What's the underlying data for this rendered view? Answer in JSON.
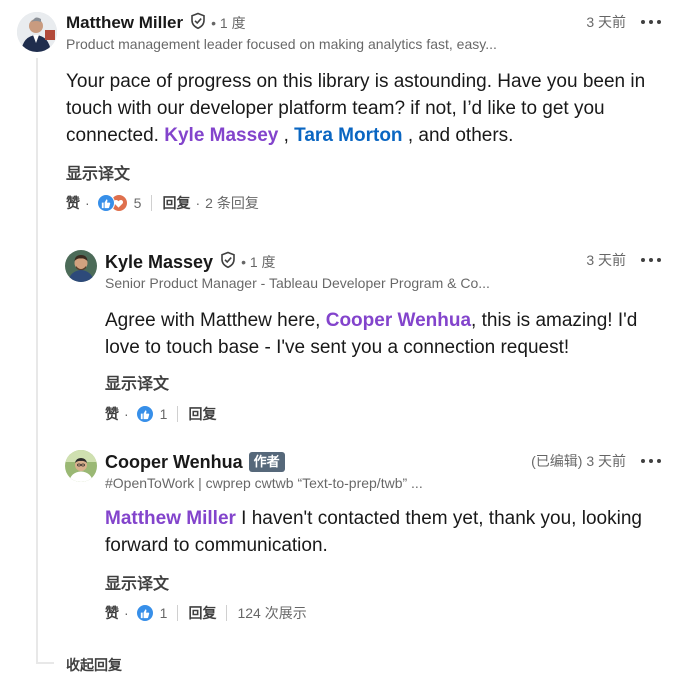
{
  "thread": {
    "collapse_label": "收起回复"
  },
  "comments": [
    {
      "name": "Matthew Miller",
      "degree": "• 1 度",
      "headline": "Product management leader focused on making analytics fast, easy...",
      "time": "3 天前",
      "text_1": "Your pace of progress on this library is astounding. Have you been in touch with our developer platform team? if not, I’d like to get you connected. ",
      "mention_1": "Kyle Massey",
      "text_2": " , ",
      "mention_2": "Tara Morton",
      "text_3": " , and others.",
      "translate": "显示译文",
      "like_label": "赞",
      "reaction_count": "5",
      "reply_label": "回复",
      "reply_count": "2 条回复"
    },
    {
      "name": "Kyle Massey",
      "degree": "• 1 度",
      "headline": "Senior Product Manager - Tableau Developer Program & Co...",
      "time": "3 天前",
      "text_1": "Agree with Matthew here, ",
      "mention_1": "Cooper Wenhua",
      "text_2": ", this is amazing! I'd love to touch base - I've sent you a connection request!",
      "translate": "显示译文",
      "like_label": "赞",
      "reaction_count": "1",
      "reply_label": "回复"
    },
    {
      "name": "Cooper Wenhua",
      "author_badge": "作者",
      "headline": "#OpenToWork | cwprep cwtwb “Text-to-prep/twb” ...",
      "edited": "(已编辑)",
      "time": "3 天前",
      "mention_1": "Matthew Miller",
      "text_1": " I haven't contacted them yet, thank you, looking forward to communication.",
      "translate": "显示译文",
      "like_label": "赞",
      "reaction_count": "1",
      "reply_label": "回复",
      "impressions": "124 次展示"
    }
  ],
  "colors": {
    "mention_purple": "#8344cc",
    "mention_blue": "#0a66c2",
    "like_blue": "#378fe9",
    "love_orange": "#df704d",
    "author_badge_bg": "#56687a"
  },
  "icons": [
    "verified-shield-icon",
    "like-reaction-icon",
    "love-reaction-icon",
    "more-options-icon"
  ]
}
